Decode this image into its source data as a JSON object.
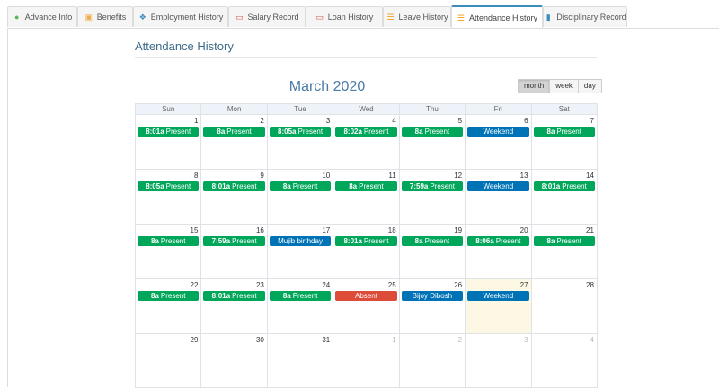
{
  "tabs": [
    {
      "label": "Advance Info",
      "icon": "user-icon",
      "color": "#5cb85c"
    },
    {
      "label": "Benefits",
      "icon": "gift-icon",
      "color": "#f0ad4e"
    },
    {
      "label": "Employment History",
      "icon": "users-icon",
      "color": "#3c8dbc"
    },
    {
      "label": "Salary Record",
      "icon": "money-icon",
      "color": "#d9534f"
    },
    {
      "label": "Loan History",
      "icon": "money-icon",
      "color": "#d9534f"
    },
    {
      "label": "Leave History",
      "icon": "list-icon",
      "color": "#f39c12"
    },
    {
      "label": "Attendance History",
      "icon": "list-icon",
      "color": "#f39c12"
    },
    {
      "label": "Disciplinary Record",
      "icon": "file-icon",
      "color": "#3c8dbc"
    }
  ],
  "active_tab": "Attendance History",
  "section_title": "Attendance History",
  "calendar": {
    "month_title": "March 2020",
    "views": [
      "month",
      "week",
      "day"
    ],
    "active_view": "month",
    "weekdays": [
      "Sun",
      "Mon",
      "Tue",
      "Wed",
      "Thu",
      "Fri",
      "Sat"
    ],
    "colors": {
      "present": "#00a65a",
      "weekend": "#0073b7",
      "holiday": "#0073b7",
      "absent": "#dd4b39"
    },
    "weeks": [
      [
        {
          "day": "1",
          "time": "8:01a",
          "label": "Present",
          "type": "present"
        },
        {
          "day": "2",
          "time": "8a",
          "label": "Present",
          "type": "present"
        },
        {
          "day": "3",
          "time": "8:05a",
          "label": "Present",
          "type": "present"
        },
        {
          "day": "4",
          "time": "8:02a",
          "label": "Present",
          "type": "present"
        },
        {
          "day": "5",
          "time": "8a",
          "label": "Present",
          "type": "present"
        },
        {
          "day": "6",
          "time": "",
          "label": "Weekend",
          "type": "weekend"
        },
        {
          "day": "7",
          "time": "8a",
          "label": "Present",
          "type": "present"
        }
      ],
      [
        {
          "day": "8",
          "time": "8:05a",
          "label": "Present",
          "type": "present"
        },
        {
          "day": "9",
          "time": "8:01a",
          "label": "Present",
          "type": "present"
        },
        {
          "day": "10",
          "time": "8a",
          "label": "Present",
          "type": "present"
        },
        {
          "day": "11",
          "time": "8a",
          "label": "Present",
          "type": "present"
        },
        {
          "day": "12",
          "time": "7:59a",
          "label": "Present",
          "type": "present"
        },
        {
          "day": "13",
          "time": "",
          "label": "Weekend",
          "type": "weekend"
        },
        {
          "day": "14",
          "time": "8:01a",
          "label": "Present",
          "type": "present"
        }
      ],
      [
        {
          "day": "15",
          "time": "8a",
          "label": "Present",
          "type": "present"
        },
        {
          "day": "16",
          "time": "7:59a",
          "label": "Present",
          "type": "present"
        },
        {
          "day": "17",
          "time": "",
          "label": "Mujib birthday",
          "type": "holiday"
        },
        {
          "day": "18",
          "time": "8:01a",
          "label": "Present",
          "type": "present"
        },
        {
          "day": "19",
          "time": "8a",
          "label": "Present",
          "type": "present"
        },
        {
          "day": "20",
          "time": "8:06a",
          "label": "Present",
          "type": "present"
        },
        {
          "day": "21",
          "time": "8a",
          "label": "Present",
          "type": "present"
        }
      ],
      [
        {
          "day": "22",
          "time": "8a",
          "label": "Present",
          "type": "present"
        },
        {
          "day": "23",
          "time": "8:01a",
          "label": "Present",
          "type": "present"
        },
        {
          "day": "24",
          "time": "8a",
          "label": "Present",
          "type": "present"
        },
        {
          "day": "25",
          "time": "",
          "label": "Absent",
          "type": "absent"
        },
        {
          "day": "26",
          "time": "",
          "label": "Bijoy Dibosh",
          "type": "holiday"
        },
        {
          "day": "27",
          "time": "",
          "label": "Weekend",
          "type": "weekend",
          "today": true
        },
        {
          "day": "28"
        }
      ],
      [
        {
          "day": "29"
        },
        {
          "day": "30"
        },
        {
          "day": "31"
        },
        {
          "day": "1",
          "other": true
        },
        {
          "day": "2",
          "other": true
        },
        {
          "day": "3",
          "other": true
        },
        {
          "day": "4",
          "other": true
        }
      ]
    ]
  }
}
